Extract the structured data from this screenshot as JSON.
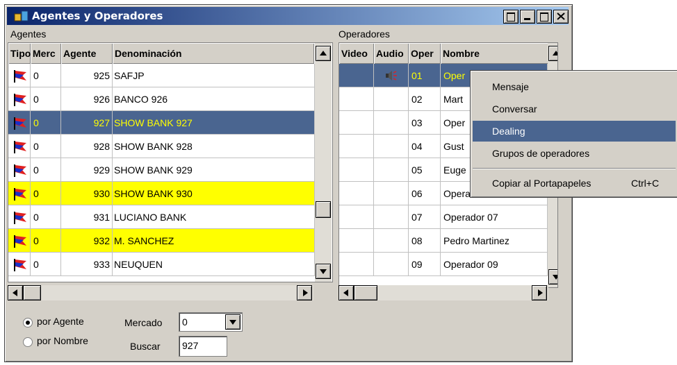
{
  "window": {
    "title": "Agentes y Operadores"
  },
  "agentes": {
    "section_label": "Agentes",
    "columns": [
      "Tipo",
      "Merc",
      "Agente",
      "Denominación"
    ],
    "rows": [
      {
        "merc": "0",
        "agente": "925",
        "denominacion": "SAFJP",
        "state": "normal"
      },
      {
        "merc": "0",
        "agente": "926",
        "denominacion": "BANCO 926",
        "state": "normal"
      },
      {
        "merc": "0",
        "agente": "927",
        "denominacion": "SHOW BANK 927",
        "state": "selected"
      },
      {
        "merc": "0",
        "agente": "928",
        "denominacion": "SHOW BANK 928",
        "state": "normal"
      },
      {
        "merc": "0",
        "agente": "929",
        "denominacion": "SHOW BANK 929",
        "state": "normal"
      },
      {
        "merc": "0",
        "agente": "930",
        "denominacion": "SHOW BANK 930",
        "state": "highlight"
      },
      {
        "merc": "0",
        "agente": "931",
        "denominacion": "LUCIANO BANK",
        "state": "normal"
      },
      {
        "merc": "0",
        "agente": "932",
        "denominacion": "M. SANCHEZ",
        "state": "highlight"
      },
      {
        "merc": "0",
        "agente": "933",
        "denominacion": "NEUQUEN",
        "state": "normal"
      }
    ]
  },
  "operadores": {
    "section_label": "Operadores",
    "columns": [
      "Video",
      "Audio",
      "Oper",
      "Nombre"
    ],
    "rows": [
      {
        "oper": "01",
        "nombre": "Oper",
        "audio_icon": "speaker-icon",
        "state": "selected"
      },
      {
        "oper": "02",
        "nombre": "Mart",
        "state": "normal"
      },
      {
        "oper": "03",
        "nombre": "Oper",
        "state": "normal"
      },
      {
        "oper": "04",
        "nombre": "Gust",
        "state": "normal"
      },
      {
        "oper": "05",
        "nombre": "Euge",
        "state": "normal"
      },
      {
        "oper": "06",
        "nombre": "Operador 06",
        "state": "normal"
      },
      {
        "oper": "07",
        "nombre": "Operador 07",
        "state": "normal"
      },
      {
        "oper": "08",
        "nombre": "Pedro Martinez",
        "state": "normal"
      },
      {
        "oper": "09",
        "nombre": "Operador 09",
        "state": "normal"
      }
    ]
  },
  "filters": {
    "radio_agente": "por Agente",
    "radio_nombre": "por Nombre",
    "mercado_label": "Mercado",
    "mercado_value": "0",
    "buscar_label": "Buscar",
    "buscar_value": "927"
  },
  "context_menu": {
    "items": [
      {
        "label": "Mensaje",
        "shortcut": ""
      },
      {
        "label": "Conversar",
        "shortcut": ""
      },
      {
        "label": "Dealing",
        "shortcut": ""
      },
      {
        "label": "Grupos de operadores",
        "shortcut": ""
      },
      {
        "label": "Copiar al Portapapeles",
        "shortcut": "Ctrl+C"
      }
    ]
  },
  "colors": {
    "selection": "#4a6590",
    "highlight_row": "#ffff00",
    "selected_text": "#ffff00"
  }
}
